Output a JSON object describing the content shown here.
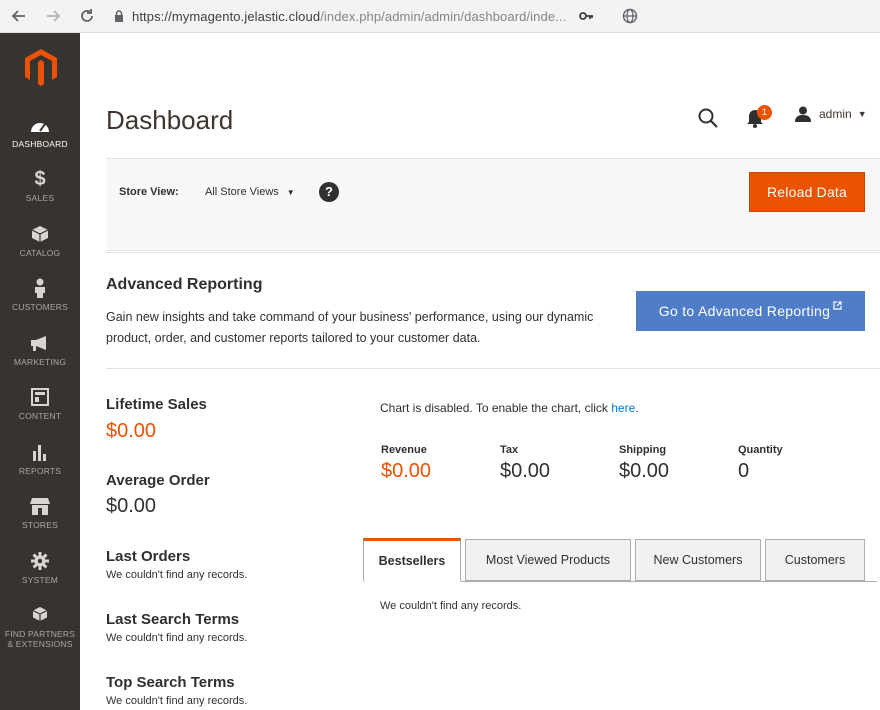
{
  "browser": {
    "url_host": "https://mymagento.jelastic.cloud",
    "url_path": "/index.php/admin/admin/dashboard/inde..."
  },
  "sidebar": {
    "items": [
      {
        "label": "DASHBOARD",
        "icon": "dashboard-icon"
      },
      {
        "label": "SALES",
        "icon": "dollar-icon"
      },
      {
        "label": "CATALOG",
        "icon": "box-icon"
      },
      {
        "label": "CUSTOMERS",
        "icon": "person-icon"
      },
      {
        "label": "MARKETING",
        "icon": "megaphone-icon"
      },
      {
        "label": "CONTENT",
        "icon": "layout-icon"
      },
      {
        "label": "REPORTS",
        "icon": "bar-chart-icon"
      },
      {
        "label": "STORES",
        "icon": "storefront-icon"
      },
      {
        "label": "SYSTEM",
        "icon": "gear-icon"
      },
      {
        "label": "FIND PARTNERS",
        "label2": "& EXTENSIONS",
        "icon": "boxes-icon"
      }
    ]
  },
  "header": {
    "title": "Dashboard",
    "notification_count": "1",
    "user": "admin"
  },
  "store_bar": {
    "label": "Store View:",
    "selected": "All Store Views",
    "help": "?",
    "reload_label": "Reload Data"
  },
  "advanced_reporting": {
    "title": "Advanced Reporting",
    "description": "Gain new insights and take command of your business' performance, using our dynamic product, order, and customer reports tailored to your customer data.",
    "button_label": "Go to Advanced Reporting"
  },
  "stats": {
    "lifetime_sales_label": "Lifetime Sales",
    "lifetime_sales_value": "$0.00",
    "average_order_label": "Average Order",
    "average_order_value": "$0.00",
    "last_orders_label": "Last Orders",
    "last_orders_note": "We couldn't find any records.",
    "last_search_label": "Last Search Terms",
    "last_search_note": "We couldn't find any records.",
    "top_search_label": "Top Search Terms",
    "top_search_note": "We couldn't find any records."
  },
  "chart": {
    "message": "Chart is disabled. To enable the chart, click ",
    "link": "here",
    "period": "."
  },
  "totals": [
    {
      "label": "Revenue",
      "value": "$0.00"
    },
    {
      "label": "Tax",
      "value": "$0.00"
    },
    {
      "label": "Shipping",
      "value": "$0.00"
    },
    {
      "label": "Quantity",
      "value": "0"
    }
  ],
  "tabs": {
    "items": [
      "Bestsellers",
      "Most Viewed Products",
      "New Customers",
      "Customers"
    ],
    "active": "Bestsellers",
    "content": "We couldn't find any records."
  },
  "colors": {
    "accent": "#eb5202",
    "sidebar": "#373330",
    "advanced_button": "#507dc8"
  }
}
